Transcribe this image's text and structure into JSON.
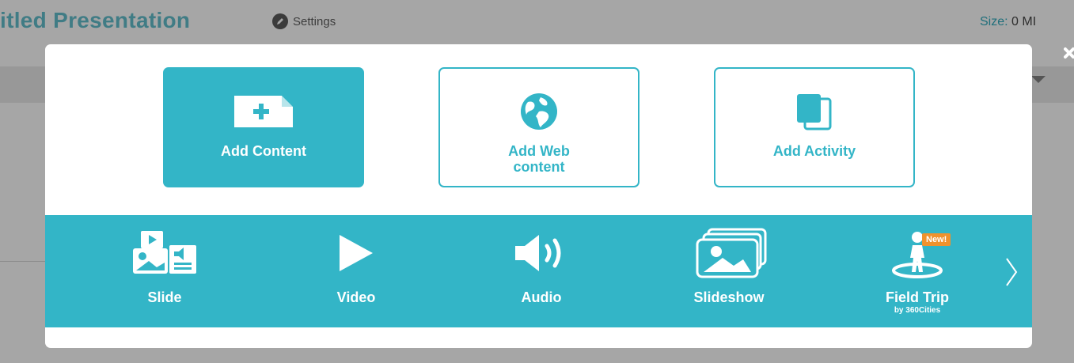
{
  "app": {
    "title": "itled Presentation",
    "settings_label": "Settings",
    "size_label": "Size:",
    "size_value": "0 MI"
  },
  "modal": {
    "close_icon": "close-icon",
    "cards": [
      {
        "label": "Add Content",
        "sub": "",
        "icon": "add-page-icon"
      },
      {
        "label": "Add Web",
        "sub": "content",
        "icon": "globe-icon"
      },
      {
        "label": "Add Activity",
        "sub": "",
        "icon": "activity-icon"
      }
    ],
    "media": [
      {
        "label": "Slide",
        "sub": "",
        "icon": "slide-icon"
      },
      {
        "label": "Video",
        "sub": "",
        "icon": "play-icon"
      },
      {
        "label": "Audio",
        "sub": "",
        "icon": "speaker-icon"
      },
      {
        "label": "Slideshow",
        "sub": "",
        "icon": "slideshow-icon"
      },
      {
        "label": "Field Trip",
        "sub": "by 360Cities",
        "icon": "field-trip-icon",
        "badge": "New!"
      }
    ]
  },
  "colors": {
    "accent": "#33b5c7",
    "badge": "#f0922d",
    "overlay": "#a6a6a6"
  }
}
